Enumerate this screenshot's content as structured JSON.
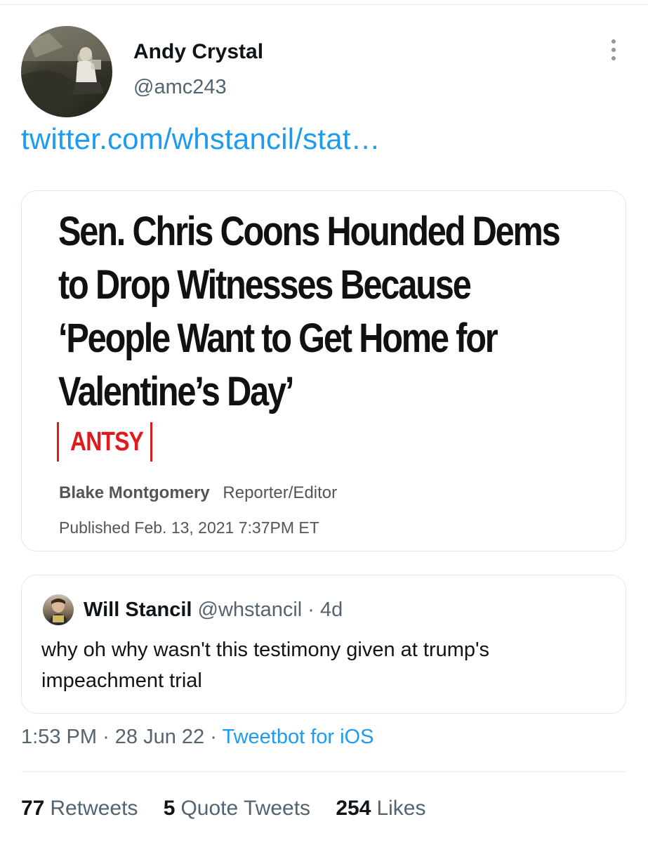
{
  "author": {
    "name": "Andy Crystal",
    "handle": "@amc243",
    "avatar_icon": "profile-photo"
  },
  "tweet": {
    "link_text": "twitter.com/whstancil/stat…"
  },
  "article_card": {
    "headline_lines": [
      "Sen. Chris Coons Hounded Dems",
      "to Drop Witnesses Because",
      "‘People Want to Get Home for",
      "Valentine’s Day’"
    ],
    "kicker": "ANTSY",
    "author_name": "Blake Montgomery",
    "author_role": "Reporter/Editor",
    "published": "Published Feb. 13, 2021 7:37PM ET",
    "accent_color": "#e0191d"
  },
  "quoted_tweet": {
    "name": "Will Stancil",
    "handle": "@whstancil",
    "separator": "·",
    "age": "4d",
    "text": "why oh why wasn't this testimony given at trump's impeachment trial"
  },
  "meta": {
    "time": "1:53 PM",
    "sep1": "·",
    "date": "28 Jun 22",
    "sep2": "·",
    "source": "Tweetbot for iOS"
  },
  "stats": {
    "retweets_count": "77",
    "retweets_label": "Retweets",
    "quotes_count": "5",
    "quotes_label": "Quote Tweets",
    "likes_count": "254",
    "likes_label": "Likes"
  },
  "colors": {
    "link": "#1d9bf0",
    "secondary_text": "#536471"
  }
}
